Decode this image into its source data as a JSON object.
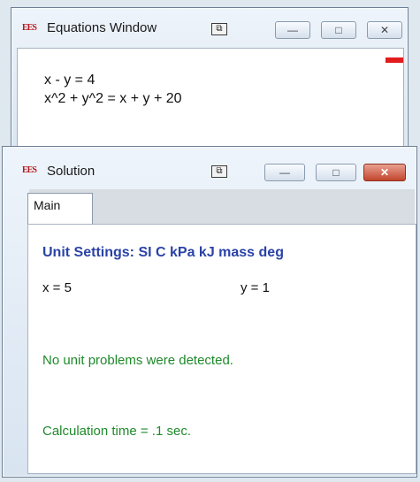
{
  "equations_window": {
    "title": "Equations Window",
    "icon_text": "EES",
    "lines": [
      "x - y = 4",
      "x^2 + y^2 = x + y + 20"
    ],
    "controls": {
      "minimize": "—",
      "maximize": "□",
      "close": "✕"
    }
  },
  "solution_window": {
    "title": "Solution",
    "icon_text": "EES",
    "controls": {
      "minimize": "—",
      "maximize": "□",
      "close": "✕"
    },
    "tabs": [
      {
        "label": "Main"
      }
    ],
    "unit_settings": "Unit Settings: SI C kPa kJ mass deg",
    "results": [
      {
        "text": "x = 5"
      },
      {
        "text": "y = 1"
      }
    ],
    "unit_check": "No unit problems were detected.",
    "calc_time": "Calculation time = .1 sec."
  },
  "colors": {
    "unit_settings": "#2a43a6",
    "messages": "#1e8a2a",
    "error_mark": "#e21b1b"
  }
}
